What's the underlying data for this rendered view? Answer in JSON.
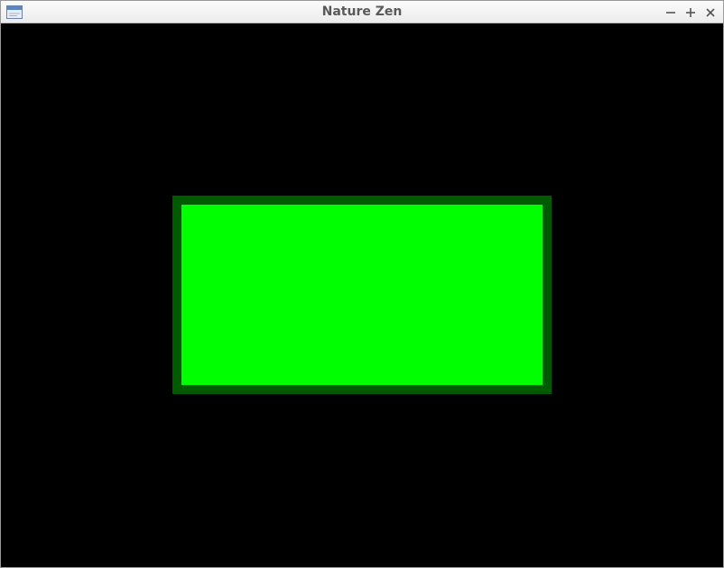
{
  "window": {
    "title": "Nature Zen"
  },
  "icons": {
    "app": "app-window-icon",
    "minimize": "minimize-icon",
    "maximize": "maximize-icon",
    "close": "close-icon"
  },
  "colors": {
    "background": "#000000",
    "rect_fill": "#00ff00",
    "rect_border": "#005a00"
  }
}
